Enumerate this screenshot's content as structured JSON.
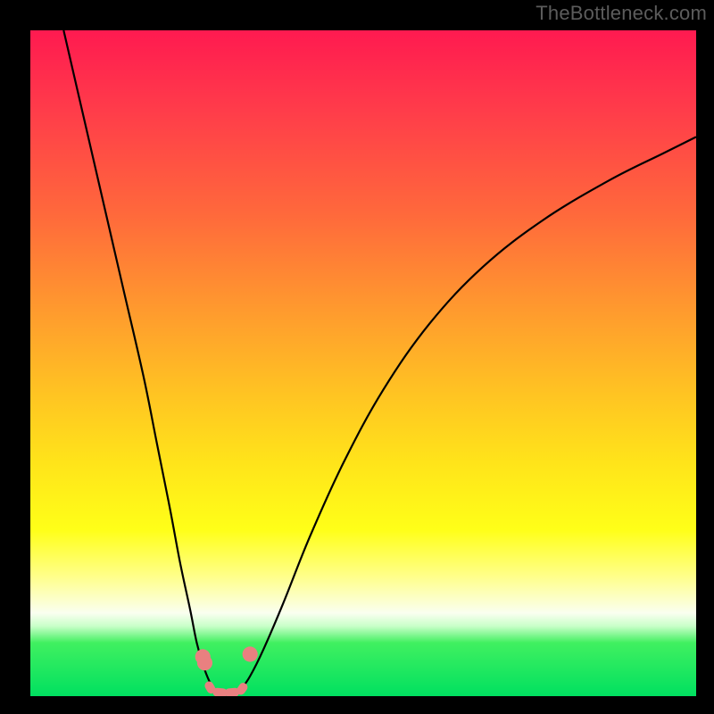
{
  "watermark": "TheBottleneck.com",
  "chart_data": {
    "type": "line",
    "title": "",
    "xlabel": "",
    "ylabel": "",
    "xlim": [
      0,
      100
    ],
    "ylim": [
      0,
      100
    ],
    "grid": false,
    "legend": false,
    "series": [
      {
        "name": "left-curve",
        "x": [
          5,
          8,
          11,
          14,
          17,
          19,
          21,
          22.5,
          24,
          25,
          26,
          27,
          27.8
        ],
        "y": [
          100,
          87,
          74,
          61,
          48,
          38,
          28,
          20,
          13,
          8,
          4.5,
          2,
          0.8
        ]
      },
      {
        "name": "right-curve",
        "x": [
          31.5,
          33,
          35,
          38,
          42,
          47,
          53,
          60,
          68,
          77,
          87,
          95,
          100
        ],
        "y": [
          0.8,
          3,
          7,
          14,
          24,
          35,
          46,
          56,
          64.5,
          71.5,
          77.5,
          81.5,
          84
        ]
      }
    ],
    "markers": [
      {
        "shape": "dot",
        "x": 25.9,
        "y": 5.9,
        "r": 1.15
      },
      {
        "shape": "dot",
        "x": 26.2,
        "y": 5.0,
        "r": 1.15
      },
      {
        "shape": "dot",
        "x": 33.0,
        "y": 6.3,
        "r": 1.15
      },
      {
        "shape": "pill",
        "x": 27.0,
        "y": 1.3,
        "w": 1.9,
        "h": 1.3,
        "angle": 60
      },
      {
        "shape": "pill",
        "x": 28.5,
        "y": 0.55,
        "w": 2.2,
        "h": 1.3,
        "angle": 5
      },
      {
        "shape": "pill",
        "x": 30.3,
        "y": 0.55,
        "w": 2.2,
        "h": 1.3,
        "angle": -5
      },
      {
        "shape": "pill",
        "x": 31.8,
        "y": 1.1,
        "w": 1.9,
        "h": 1.3,
        "angle": -55
      }
    ],
    "background_gradient": {
      "top": "#ff1a50",
      "middle": "#ffe41a",
      "bottom": "#00e060"
    }
  }
}
